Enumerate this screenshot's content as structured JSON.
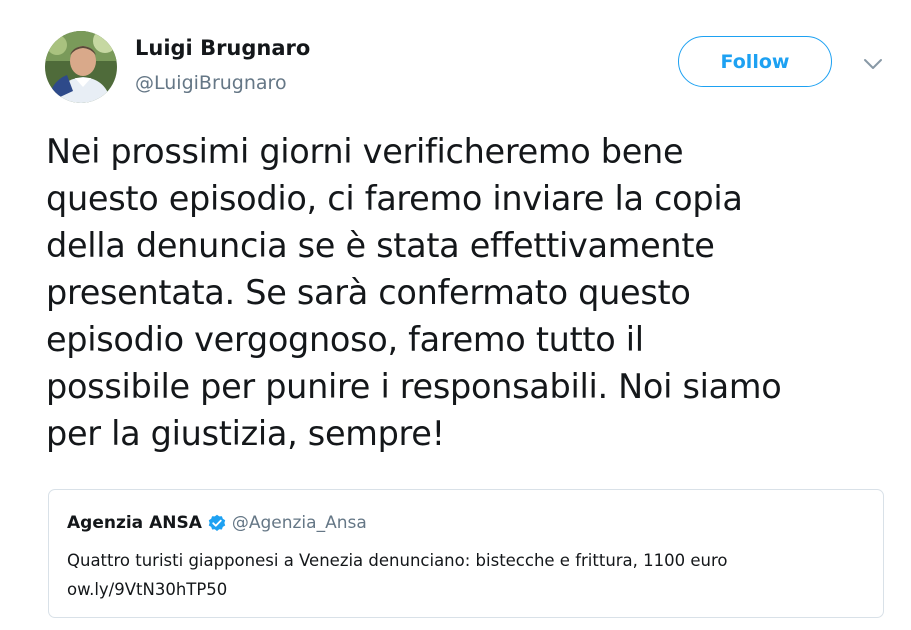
{
  "author": {
    "display_name": "Luigi Brugnaro",
    "handle": "@LuigiBrugnaro",
    "avatar": "avatar-photo"
  },
  "actions": {
    "follow_label": "Follow",
    "more_icon": "chevron-down-icon"
  },
  "tweet": {
    "text_lines": [
      "Nei prossimi giorni verificheremo bene",
      "questo episodio, ci faremo inviare la copia",
      "della denuncia se è stata effettivamente",
      "presentata. Se sarà confermato questo",
      "episodio vergognoso, faremo tutto il",
      "possibile per punire i responsabili. Noi siamo",
      "per la giustizia, sempre!"
    ]
  },
  "quoted_tweet": {
    "display_name": "Agenzia ANSA",
    "verified_icon": "verified-badge-icon",
    "handle": "@Agenzia_Ansa",
    "text": "Quattro turisti giapponesi a Venezia denunciano: bistecche e frittura, 1100 euro",
    "link": "ow.ly/9VtN30hTP50"
  },
  "colors": {
    "accent": "#1da1f2",
    "text": "#14171a",
    "secondary_text": "#657786",
    "border": "#d9e1e8"
  }
}
